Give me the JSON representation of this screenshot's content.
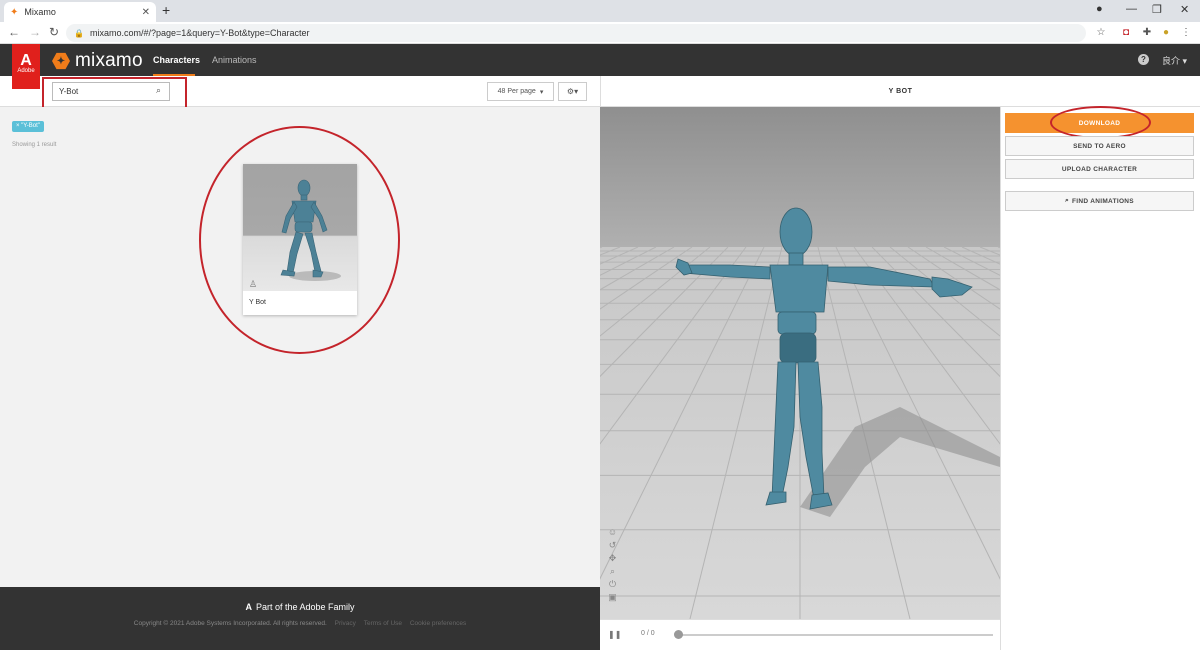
{
  "browser": {
    "tab_title": "Mixamo",
    "tab_favicon": "mixamo-favicon",
    "new_tab": "+",
    "url": "mixamo.com/#/?page=1&query=Y-Bot&type=Character"
  },
  "header": {
    "adobe_badge": "Adobe",
    "logo_text": "mixamo",
    "tabs": [
      {
        "label": "Characters"
      },
      {
        "label": "Animations"
      }
    ],
    "help": "?",
    "user_name": "良介"
  },
  "search": {
    "value": "Y-Bot",
    "per_page": "48 Per page",
    "filter_chip": "× \"Y-Bot\"",
    "result_count": "Showing 1 result"
  },
  "results": [
    {
      "name": "Y Bot"
    }
  ],
  "viewer": {
    "title": "Y BOT",
    "frame_counter": "0 / 0"
  },
  "actions": {
    "download": "DOWNLOAD",
    "send_to_aero": "SEND TO AERO",
    "upload_character": "UPLOAD CHARACTER",
    "find_animations": "FIND ANIMATIONS"
  },
  "footer": {
    "family": "Part of the Adobe Family",
    "copyright": "Copyright © 2021 Adobe Systems Incorporated. All rights reserved.",
    "links": [
      "Privacy",
      "Terms of Use",
      "Cookie preferences"
    ]
  },
  "colors": {
    "accent": "#f07c1a",
    "download": "#f5922f",
    "chip": "#5bc0d8",
    "annotation": "#c4242b",
    "character": "#4c8196"
  }
}
